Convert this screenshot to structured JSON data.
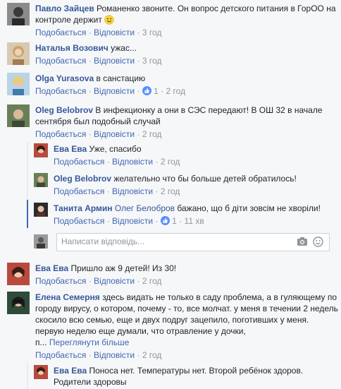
{
  "comments": [
    {
      "name": "Павло Зайцев",
      "text": "Романенко звоните. Он вопрос детского питания в ГорОО на контроле держит",
      "like": "Подобається",
      "reply": "Відповісти",
      "time": "3 год"
    },
    {
      "name": "Наталья Возович",
      "text": "ужас...",
      "like": "Подобається",
      "reply": "Відповісти",
      "time": "3 год"
    },
    {
      "name": "Olga Yurasova",
      "text": "в санстацию",
      "like": "Подобається",
      "reply": "Відповісти",
      "likes": "1",
      "time": "2 год"
    },
    {
      "name": "Oleg Belobrov",
      "text": "В инфекционку а они в СЭС передают! В ОШ 32 в начале сентября был подобный случай",
      "like": "Подобається",
      "reply": "Відповісти",
      "time": "2 год"
    }
  ],
  "replies": [
    {
      "name": "Ева Ева",
      "text": "Уже, спасибо",
      "like": "Подобається",
      "reply": "Відповісти",
      "time": "2 год"
    },
    {
      "name": "Oleg Belobrov",
      "text": "желательно что бы больше детей обратилось!",
      "like": "Подобається",
      "reply": "Відповісти",
      "time": "2 год"
    },
    {
      "name": "Танита Армин",
      "mention": "Олег Белобров",
      "text": "бажано, що б діти зовсім не хворіли!",
      "like": "Подобається",
      "reply": "Відповісти",
      "likes": "1",
      "time": "11 хв"
    }
  ],
  "reply_input": {
    "placeholder": "Написати відповідь..."
  },
  "comments2": [
    {
      "name": "Ева Ева",
      "text": "Пришло аж 9 детей! Из 30!",
      "like": "Подобається",
      "reply": "Відповісти",
      "time": "2 год"
    },
    {
      "name": "Елена Семерня",
      "text": "здесь видать не только в саду проблема, а в гуляющему по городу вирусу, о котором, почему - то, все молчат. у меня в течении 2 недель скосило всю семью, еще и двух подруг зацепило, поготивших у меня. первую неделю еще думали, что отравление у дочки,",
      "text_end": "п...",
      "see_more": "Переглянути більше",
      "like": "Подобається",
      "reply": "Відповісти",
      "time": "2 год"
    }
  ],
  "last_reply": {
    "name": "Ева Ева",
    "text": "Поноса нет. Температуры нет. Второй ребёнок здоров. Родители здоровы"
  },
  "colors": {
    "link": "#365899",
    "action": "#4267b2",
    "meta": "#90949c",
    "like_badge": "#5890ff"
  }
}
